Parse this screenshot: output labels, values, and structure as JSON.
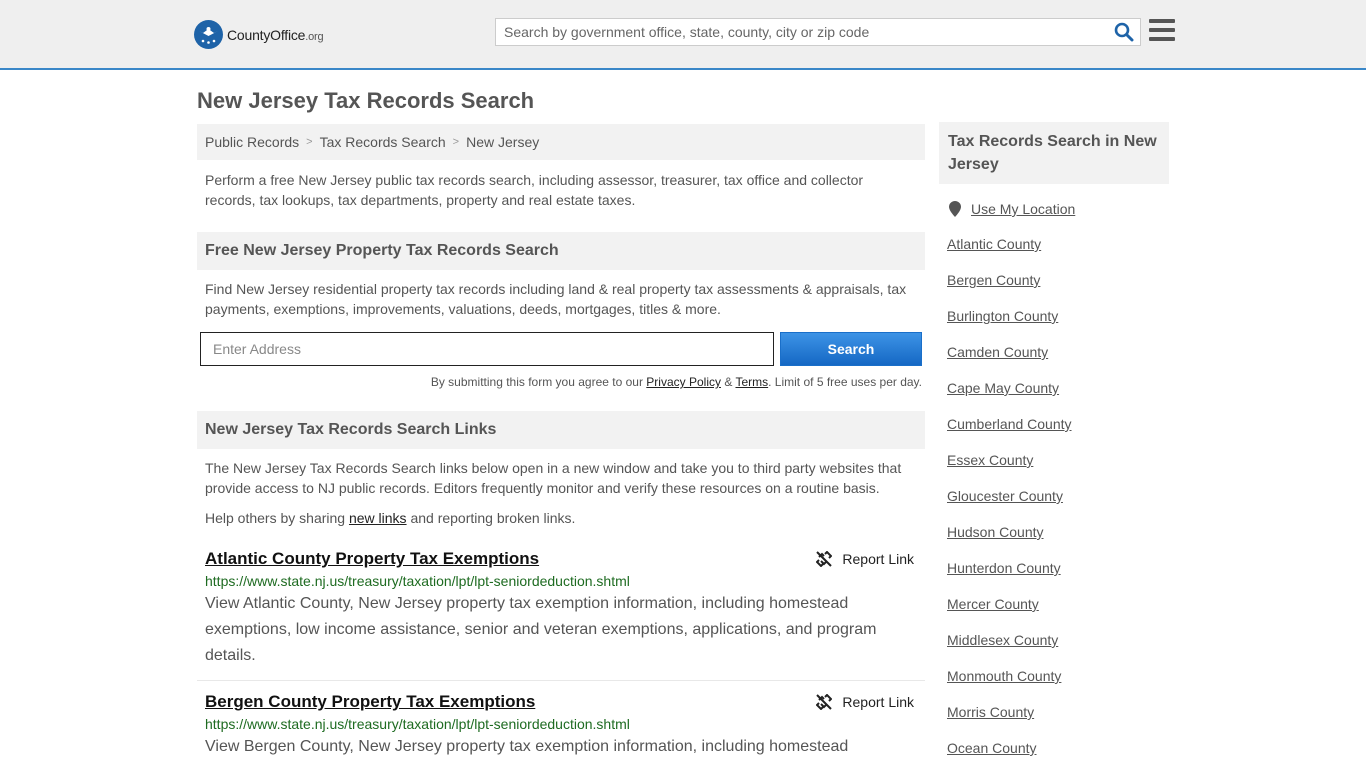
{
  "header": {
    "logo_text": "CountyOffice",
    "logo_suffix": ".org",
    "search_placeholder": "Search by government office, state, county, city or zip code"
  },
  "page": {
    "title": "New Jersey Tax Records Search",
    "breadcrumb": [
      "Public Records",
      "Tax Records Search",
      "New Jersey"
    ],
    "intro": "Perform a free New Jersey public tax records search, including assessor, treasurer, tax office and collector records, tax lookups, tax departments, property and real estate taxes."
  },
  "property_search": {
    "heading": "Free New Jersey Property Tax Records Search",
    "description": "Find New Jersey residential property tax records including land & real property tax assessments & appraisals, tax payments, exemptions, improvements, valuations, deeds, mortgages, titles & more.",
    "address_placeholder": "Enter Address",
    "button_label": "Search",
    "disclaimer_prefix": "By submitting this form you agree to our",
    "privacy_label": "Privacy Policy",
    "amp": "&",
    "terms_label": "Terms",
    "disclaimer_suffix": ". Limit of 5 free uses per day."
  },
  "links_section": {
    "heading": "New Jersey Tax Records Search Links",
    "description": "The New Jersey Tax Records Search links below open in a new window and take you to third party websites that provide access to NJ public records. Editors frequently monitor and verify these resources on a routine basis.",
    "share_prefix": "Help others by sharing",
    "share_link": "new links",
    "share_suffix": "and reporting broken links.",
    "report_label": "Report Link",
    "results": [
      {
        "title": "Atlantic County Property Tax Exemptions",
        "url": "https://www.state.nj.us/treasury/taxation/lpt/lpt-seniordeduction.shtml",
        "description": "View Atlantic County, New Jersey property tax exemption information, including homestead exemptions, low income assistance, senior and veteran exemptions, applications, and program details."
      },
      {
        "title": "Bergen County Property Tax Exemptions",
        "url": "https://www.state.nj.us/treasury/taxation/lpt/lpt-seniordeduction.shtml",
        "description": "View Bergen County, New Jersey property tax exemption information, including homestead"
      }
    ]
  },
  "sidebar": {
    "heading": "Tax Records Search in New Jersey",
    "location_label": "Use My Location",
    "counties": [
      "Atlantic County",
      "Bergen County",
      "Burlington County",
      "Camden County",
      "Cape May County",
      "Cumberland County",
      "Essex County",
      "Gloucester County",
      "Hudson County",
      "Hunterdon County",
      "Mercer County",
      "Middlesex County",
      "Monmouth County",
      "Morris County",
      "Ocean County"
    ]
  },
  "colors": {
    "accent": "#3a87c8",
    "button": "#1568c4",
    "url_green": "#1e6b21"
  }
}
